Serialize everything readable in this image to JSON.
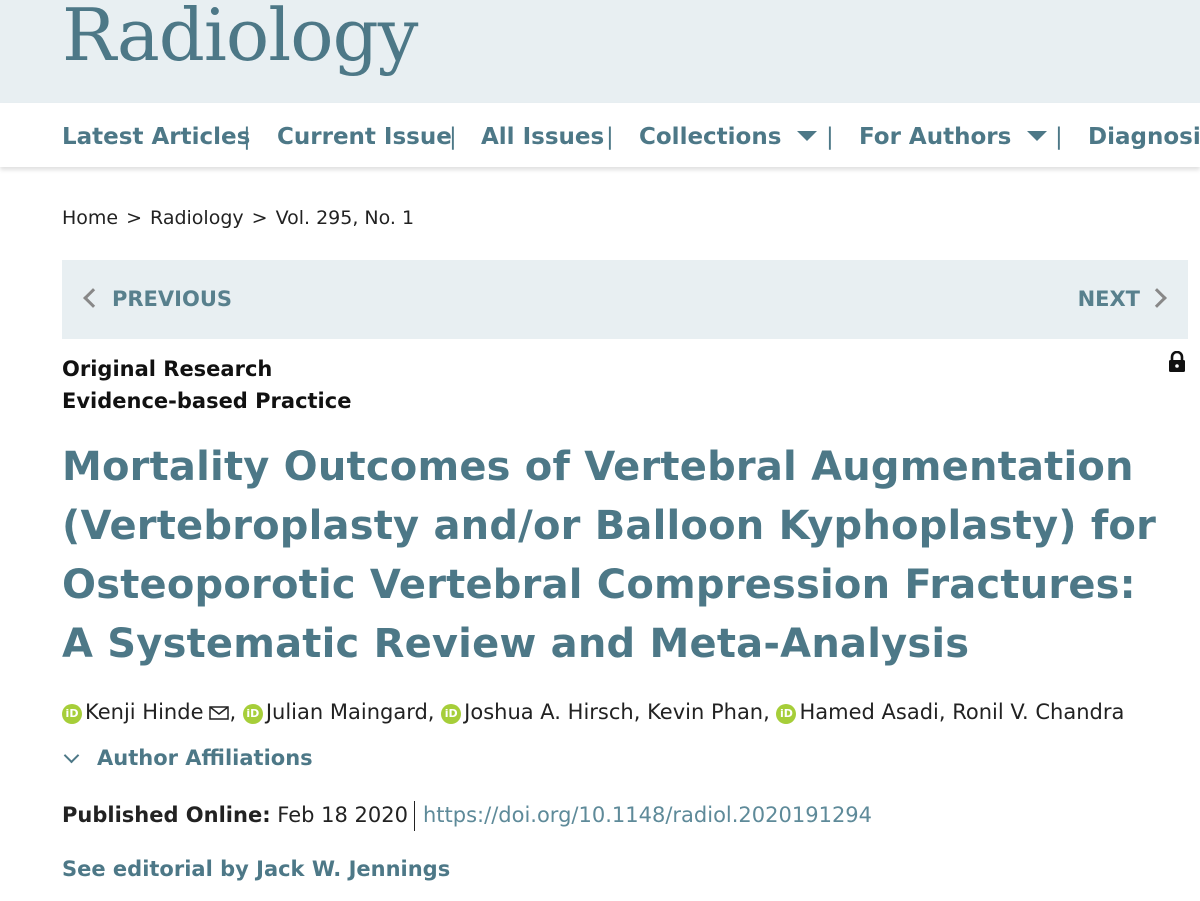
{
  "masthead": {
    "logo": "Radiology"
  },
  "nav": {
    "items": [
      {
        "label": "Latest Articles"
      },
      {
        "label": "Current Issue"
      },
      {
        "label": "All Issues"
      },
      {
        "label": "Collections",
        "dropdown": true
      },
      {
        "label": "For Authors",
        "dropdown": true
      },
      {
        "label": "Diagnosis"
      }
    ],
    "separator": "|"
  },
  "breadcrumb": {
    "items": [
      "Home",
      "Radiology",
      "Vol. 295, No. 1"
    ],
    "separator": ">"
  },
  "pager": {
    "previous": "PREVIOUS",
    "next": "NEXT"
  },
  "article": {
    "type_line1": "Original Research",
    "type_line2": "Evidence-based Practice",
    "title": "Mortality Outcomes of Vertebral Augmentation (Vertebroplasty and/or Balloon Kyphoplasty) for Osteoporotic Vertebral Compression Fractures: A Systematic Review and Meta-Analysis",
    "authors": [
      {
        "name": "Kenji Hinde",
        "orcid": true,
        "email": true
      },
      {
        "name": "Julian Maingard",
        "orcid": true
      },
      {
        "name": "Joshua A. Hirsch",
        "orcid": true
      },
      {
        "name": "Kevin Phan",
        "orcid": false
      },
      {
        "name": "Hamed Asadi",
        "orcid": true
      },
      {
        "name": "Ronil V. Chandra",
        "orcid": false
      }
    ],
    "orcid_label": "iD",
    "affiliations_label": "Author Affiliations",
    "published_label": "Published Online:",
    "published_date": "Feb 18 2020",
    "doi": "https://doi.org/10.1148/radiol.2020191294",
    "editorial": "See editorial by Jack W. Jennings"
  },
  "icons": {
    "lock": "lock-icon",
    "email": "email-icon",
    "orcid": "orcid-icon"
  },
  "colors": {
    "brand": "#4d7887",
    "panel": "#e8eff2",
    "orcid": "#a6ce39"
  }
}
